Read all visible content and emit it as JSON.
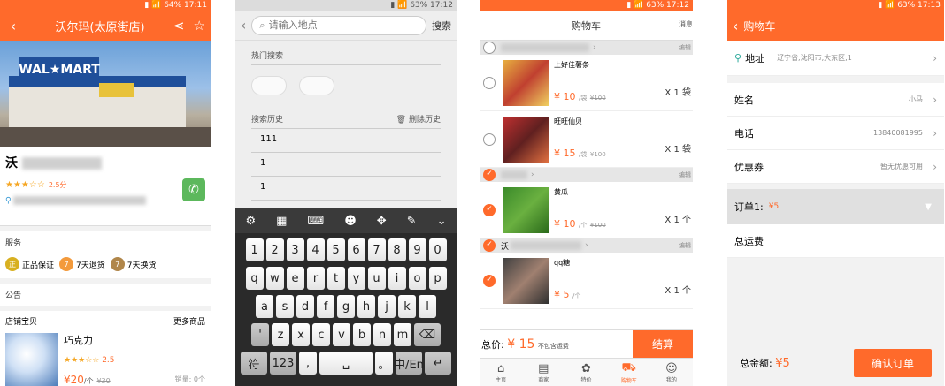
{
  "screen1": {
    "title": "沃尔玛(太原街店)",
    "store_name_prefix": "沃",
    "rating_value": "2.5分",
    "services_title": "服务",
    "badges": [
      {
        "icon": "正",
        "label": "正品保证",
        "color": "#d8b020"
      },
      {
        "icon": "7",
        "label": "7天退货",
        "color": "#f39a3c"
      },
      {
        "icon": "7",
        "label": "7天换货",
        "color": "#b0864a"
      }
    ],
    "notice_title": "公告",
    "shop_goods": "店铺宝贝",
    "more_goods": "更多商品",
    "product": {
      "name": "巧克力",
      "rating": "2.5",
      "price": "¥20",
      "unit": "/个",
      "old_price": "¥30",
      "sold": "销量: 0个"
    }
  },
  "screen2": {
    "search_placeholder": "请输入地点",
    "search_button": "搜索",
    "hot_title": "热门搜索",
    "history_title": "搜索历史",
    "delete_history": "删除历史",
    "history": [
      "111",
      "1",
      "1"
    ],
    "kb_row1": [
      "1",
      "2",
      "3",
      "4",
      "5",
      "6",
      "7",
      "8",
      "9",
      "0"
    ],
    "kb_row2": [
      "q",
      "w",
      "e",
      "r",
      "t",
      "y",
      "u",
      "i",
      "o",
      "p"
    ],
    "kb_row3": [
      "a",
      "s",
      "d",
      "f",
      "g",
      "h",
      "j",
      "k",
      "l"
    ],
    "kb_row4": [
      "'",
      "z",
      "x",
      "c",
      "v",
      "b",
      "n",
      "m"
    ],
    "kb_row5": [
      "符",
      "123",
      ",",
      "␣",
      "。",
      "中/En",
      "↵"
    ]
  },
  "screen3": {
    "title": "购物车",
    "msg": "消息",
    "edit": "编辑",
    "group2_name": "",
    "group3_name": "沃",
    "items": [
      {
        "name": "上好佳薯条",
        "price": "¥ 10",
        "unit": "/袋",
        "old": "¥100",
        "qty": "X 1 袋",
        "checked": false
      },
      {
        "name": "旺旺仙贝",
        "price": "¥ 15",
        "unit": "/袋",
        "old": "¥100",
        "qty": "X 1 袋",
        "checked": false
      },
      {
        "name": "黄瓜",
        "price": "¥ 10",
        "unit": "/个",
        "old": "¥100",
        "qty": "X 1 个",
        "checked": true
      },
      {
        "name": "qq糖",
        "price": "¥ 5",
        "unit": "/个",
        "old": "",
        "qty": "X 1 个",
        "checked": true
      }
    ],
    "total_label": "总价:",
    "total_value": "¥ 15",
    "no_shipping": "不包含运费",
    "checkout": "结算",
    "tabs": [
      {
        "icon": "⌂",
        "label": "主页",
        "active": false
      },
      {
        "icon": "▤",
        "label": "商家",
        "active": false
      },
      {
        "icon": "✿",
        "label": "特价",
        "active": false
      },
      {
        "icon": "🛒",
        "label": "购物车",
        "active": true
      },
      {
        "icon": "☺",
        "label": "我的",
        "active": false
      }
    ]
  },
  "screen4": {
    "title": "购物车",
    "address_label": "地址",
    "address_value": "辽宁省,沈阳市,大东区,1",
    "name_label": "姓名",
    "name_value": "小马",
    "phone_label": "电话",
    "phone_value": "13840081995",
    "coupon_label": "优惠券",
    "coupon_value": "暂无优惠可用",
    "order_label": "订单1:",
    "order_amount": "¥5",
    "shipping_label": "总运费",
    "total_label": "总金额:",
    "total_value": "¥5",
    "confirm": "确认订单"
  }
}
